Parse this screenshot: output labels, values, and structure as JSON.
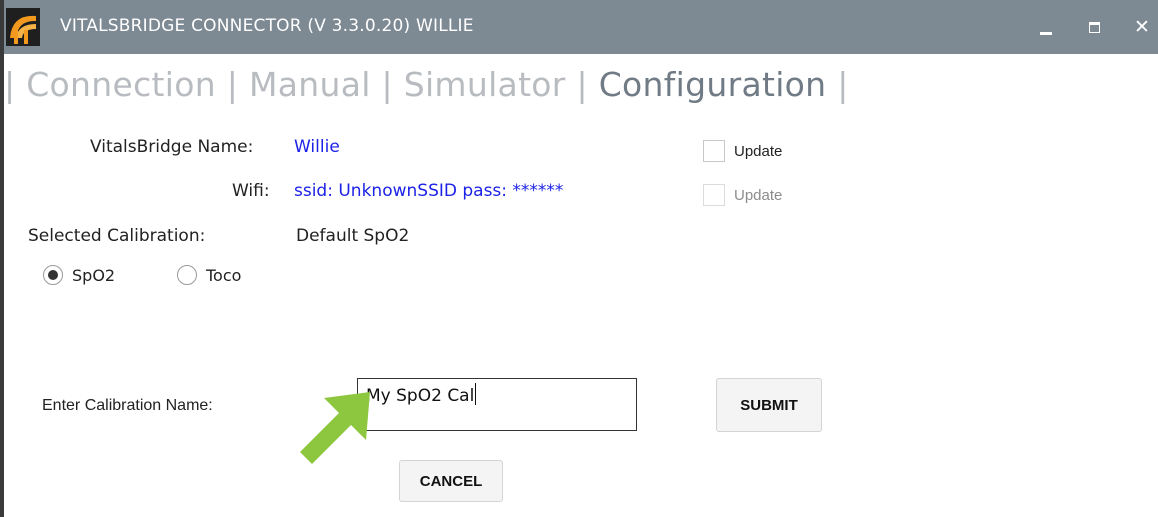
{
  "window": {
    "title": "VITALSBRIDGE CONNECTOR (V 3.3.0.20)  WILLIE",
    "controls": {
      "minimize_icon": "minimize-icon",
      "maximize_icon": "maximize-icon",
      "close_glyph": "✕"
    },
    "titlebar_color": "#7d8993"
  },
  "nav": {
    "separator": "|",
    "tabs": [
      {
        "label": "Connection",
        "active": false
      },
      {
        "label": "Manual",
        "active": false
      },
      {
        "label": "Simulator",
        "active": false
      },
      {
        "label": "Configuration",
        "active": true
      }
    ]
  },
  "config": {
    "name_label": "VitalsBridge Name:",
    "name_value": "Willie",
    "name_update_label": "Update",
    "wifi_label": "Wifi:",
    "wifi_value": "ssid: UnknownSSID  pass: ******",
    "wifi_update_label": "Update",
    "calibration_label": "Selected Calibration:",
    "calibration_value": "Default SpO2",
    "radios": [
      {
        "label": "SpO2",
        "selected": true
      },
      {
        "label": "Toco",
        "selected": false
      }
    ],
    "enter_cal_label": "Enter Calibration Name:",
    "cal_input_value": "My SpO2 Cal",
    "submit_label": "SUBMIT",
    "cancel_label": "CANCEL"
  },
  "colors": {
    "link_blue": "#1c22e6",
    "nav_inactive": "#b8bcc0",
    "nav_active": "#717b86",
    "arrow_green": "#8dc63f"
  }
}
